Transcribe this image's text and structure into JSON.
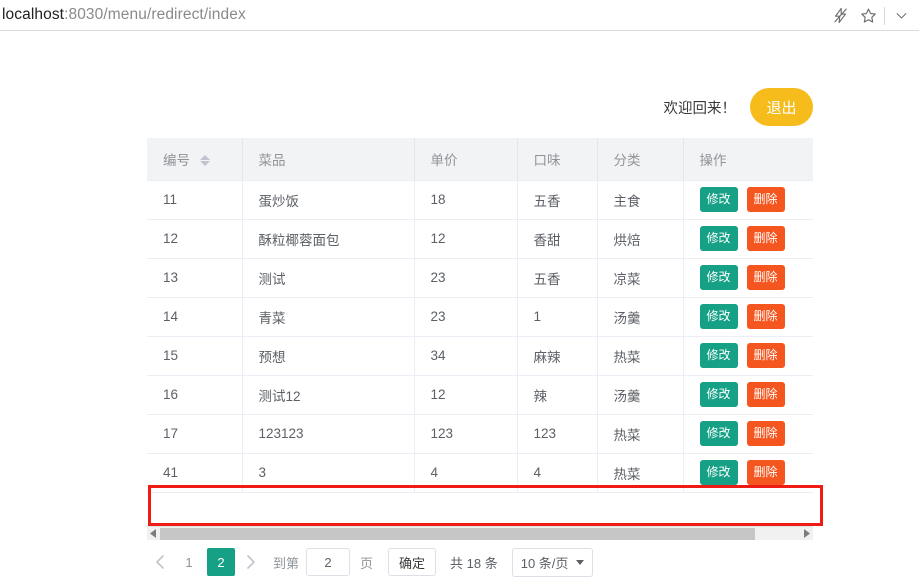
{
  "browser": {
    "url_host": "localhost",
    "url_path": ":8030/menu/redirect/index",
    "icons": {
      "lightning": "lightning-icon",
      "star": "star-icon",
      "chevron": "chevron-down-icon"
    }
  },
  "header": {
    "welcome_text": "欢迎回来！",
    "logout_label": "退出",
    "logout_color": "#f5bc1c"
  },
  "table": {
    "columns": [
      {
        "label": "编号",
        "sortable": true
      },
      {
        "label": "菜品",
        "sortable": false
      },
      {
        "label": "单价",
        "sortable": false
      },
      {
        "label": "口味",
        "sortable": false
      },
      {
        "label": "分类",
        "sortable": false
      },
      {
        "label": "操作",
        "sortable": false
      }
    ],
    "rows": [
      {
        "id": "11",
        "dish": "蛋炒饭",
        "price": "18",
        "taste": "五香",
        "category": "主食",
        "highlighted": false
      },
      {
        "id": "12",
        "dish": "酥粒椰蓉面包",
        "price": "12",
        "taste": "香甜",
        "category": "烘焙",
        "highlighted": false
      },
      {
        "id": "13",
        "dish": "测试",
        "price": "23",
        "taste": "五香",
        "category": "凉菜",
        "highlighted": false
      },
      {
        "id": "14",
        "dish": "青菜",
        "price": "23",
        "taste": "1",
        "category": "汤羹",
        "highlighted": false
      },
      {
        "id": "15",
        "dish": "预想",
        "price": "34",
        "taste": "麻辣",
        "category": "热菜",
        "highlighted": false
      },
      {
        "id": "16",
        "dish": "测试12",
        "price": "12",
        "taste": "辣",
        "category": "汤羹",
        "highlighted": false
      },
      {
        "id": "17",
        "dish": "123123",
        "price": "123",
        "taste": "123",
        "category": "热菜",
        "highlighted": false
      },
      {
        "id": "41",
        "dish": "3",
        "price": "4",
        "taste": "4",
        "category": "热菜",
        "highlighted": true
      }
    ],
    "row_actions": {
      "edit_label": "修改",
      "delete_label": "删除",
      "edit_color": "#16a085",
      "delete_color": "#f5551e"
    }
  },
  "pagination": {
    "prev_icon": "chevron-left-icon",
    "next_icon": "chevron-right-icon",
    "pages": [
      "1",
      "2"
    ],
    "active_page": "2",
    "jump_prefix": "到第",
    "jump_value": "2",
    "jump_suffix": "页",
    "confirm_label": "确定",
    "total_text": "共 18 条",
    "page_size_label": "10 条/页",
    "active_color": "#16a085"
  },
  "annotation": {
    "color": "#ef1b15"
  }
}
